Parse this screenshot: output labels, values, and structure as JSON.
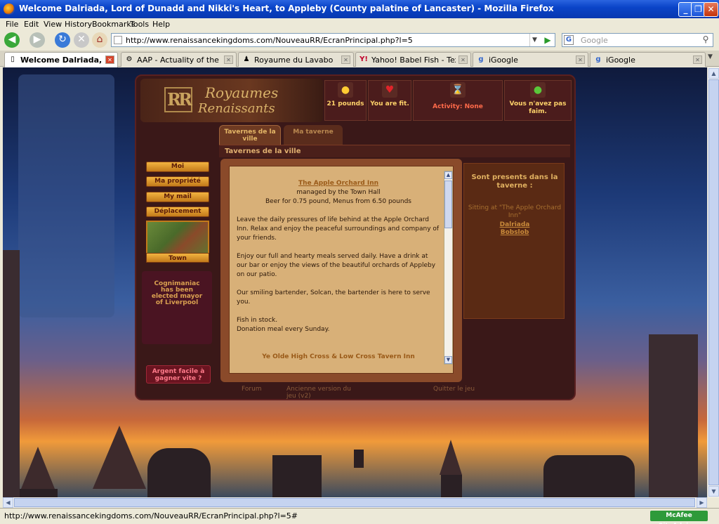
{
  "window": {
    "title": "Welcome Dalriada, Lord of Dunadd and Nikki's Heart, to Appleby (County palatine of Lancaster) - Mozilla Firefox"
  },
  "menu": [
    "File",
    "Edit",
    "View",
    "History",
    "Bookmarks",
    "Tools",
    "Help"
  ],
  "address": {
    "url": "http://www.renaissancekingdoms.com/NouveauRR/EcranPrincipal.php?l=5",
    "search_placeholder": "Google"
  },
  "tabs": [
    {
      "label": "Welcome Dalriada, Lord ...",
      "icon": "page-icon"
    },
    {
      "label": "AAP - Actuality of the Renais...",
      "icon": "gear-icon"
    },
    {
      "label": "Royaume du Lavabo",
      "icon": "person-icon"
    },
    {
      "label": "Yahoo! Babel Fish - Text Tran...",
      "icon": "yahoo-icon"
    },
    {
      "label": "iGoogle",
      "icon": "google-icon"
    },
    {
      "label": "iGoogle",
      "icon": "google-icon"
    }
  ],
  "game": {
    "logo_line1": "Royaumes",
    "logo_line2": "Renaissants",
    "logo_mark": "RR",
    "stats": [
      {
        "label": "21 pounds",
        "icon": "coins-icon"
      },
      {
        "label": "You are fit.",
        "icon": "heart-icon"
      },
      {
        "label": "Activity: None",
        "icon": "hourglass-icon"
      },
      {
        "label": "Vous n'avez pas faim.",
        "icon": "apple-icon"
      }
    ],
    "tab_tavernes": "Tavernes de la ville",
    "tab_mataverne": "Ma taverne",
    "section_title": "Tavernes de la ville",
    "menu_buttons": [
      "Moi",
      "Ma propriété",
      "My mail",
      "Déplacement"
    ],
    "town_label": "Town",
    "news": "Cognimaniac has been elected mayor of Liverpool",
    "argent_button": "Argent facile à gagner vite ?",
    "inn": {
      "title": "The Apple Orchard Inn",
      "managed": "managed by the Town Hall",
      "prices": "Beer for 0.75 pound, Menus from 6.50 pounds",
      "p1": "Leave the daily pressures of life behind at the Apple Orchard Inn. Relax and enjoy the peaceful surroundings and company of your friends.",
      "p2": "Enjoy our full and hearty meals served daily. Have a drink at our bar or enjoy the views of the beautiful orchards of Appleby on our patio.",
      "p3": "Our smiling bartender, Solcan, the bartender is here to serve you.",
      "p4a": "Fish in stock.",
      "p4b": "Donation meal every Sunday.",
      "next_inn": "Ye Olde High Cross & Low Cross Tavern Inn"
    },
    "present": {
      "title": "Sont presents dans la taverne :",
      "sitting": "Sitting at \"The Apple Orchard Inn\"",
      "people": [
        "Dalriada",
        "Bobslob"
      ]
    },
    "footer": [
      "Forum",
      "Ancienne version du jeu (v2)",
      "Quitter le jeu"
    ]
  },
  "status": {
    "url": "http://www.renaissancekingdoms.com/NouveauRR/EcranPrincipal.php?l=5#",
    "mcafee": "McAfee SiteAdvisor"
  }
}
